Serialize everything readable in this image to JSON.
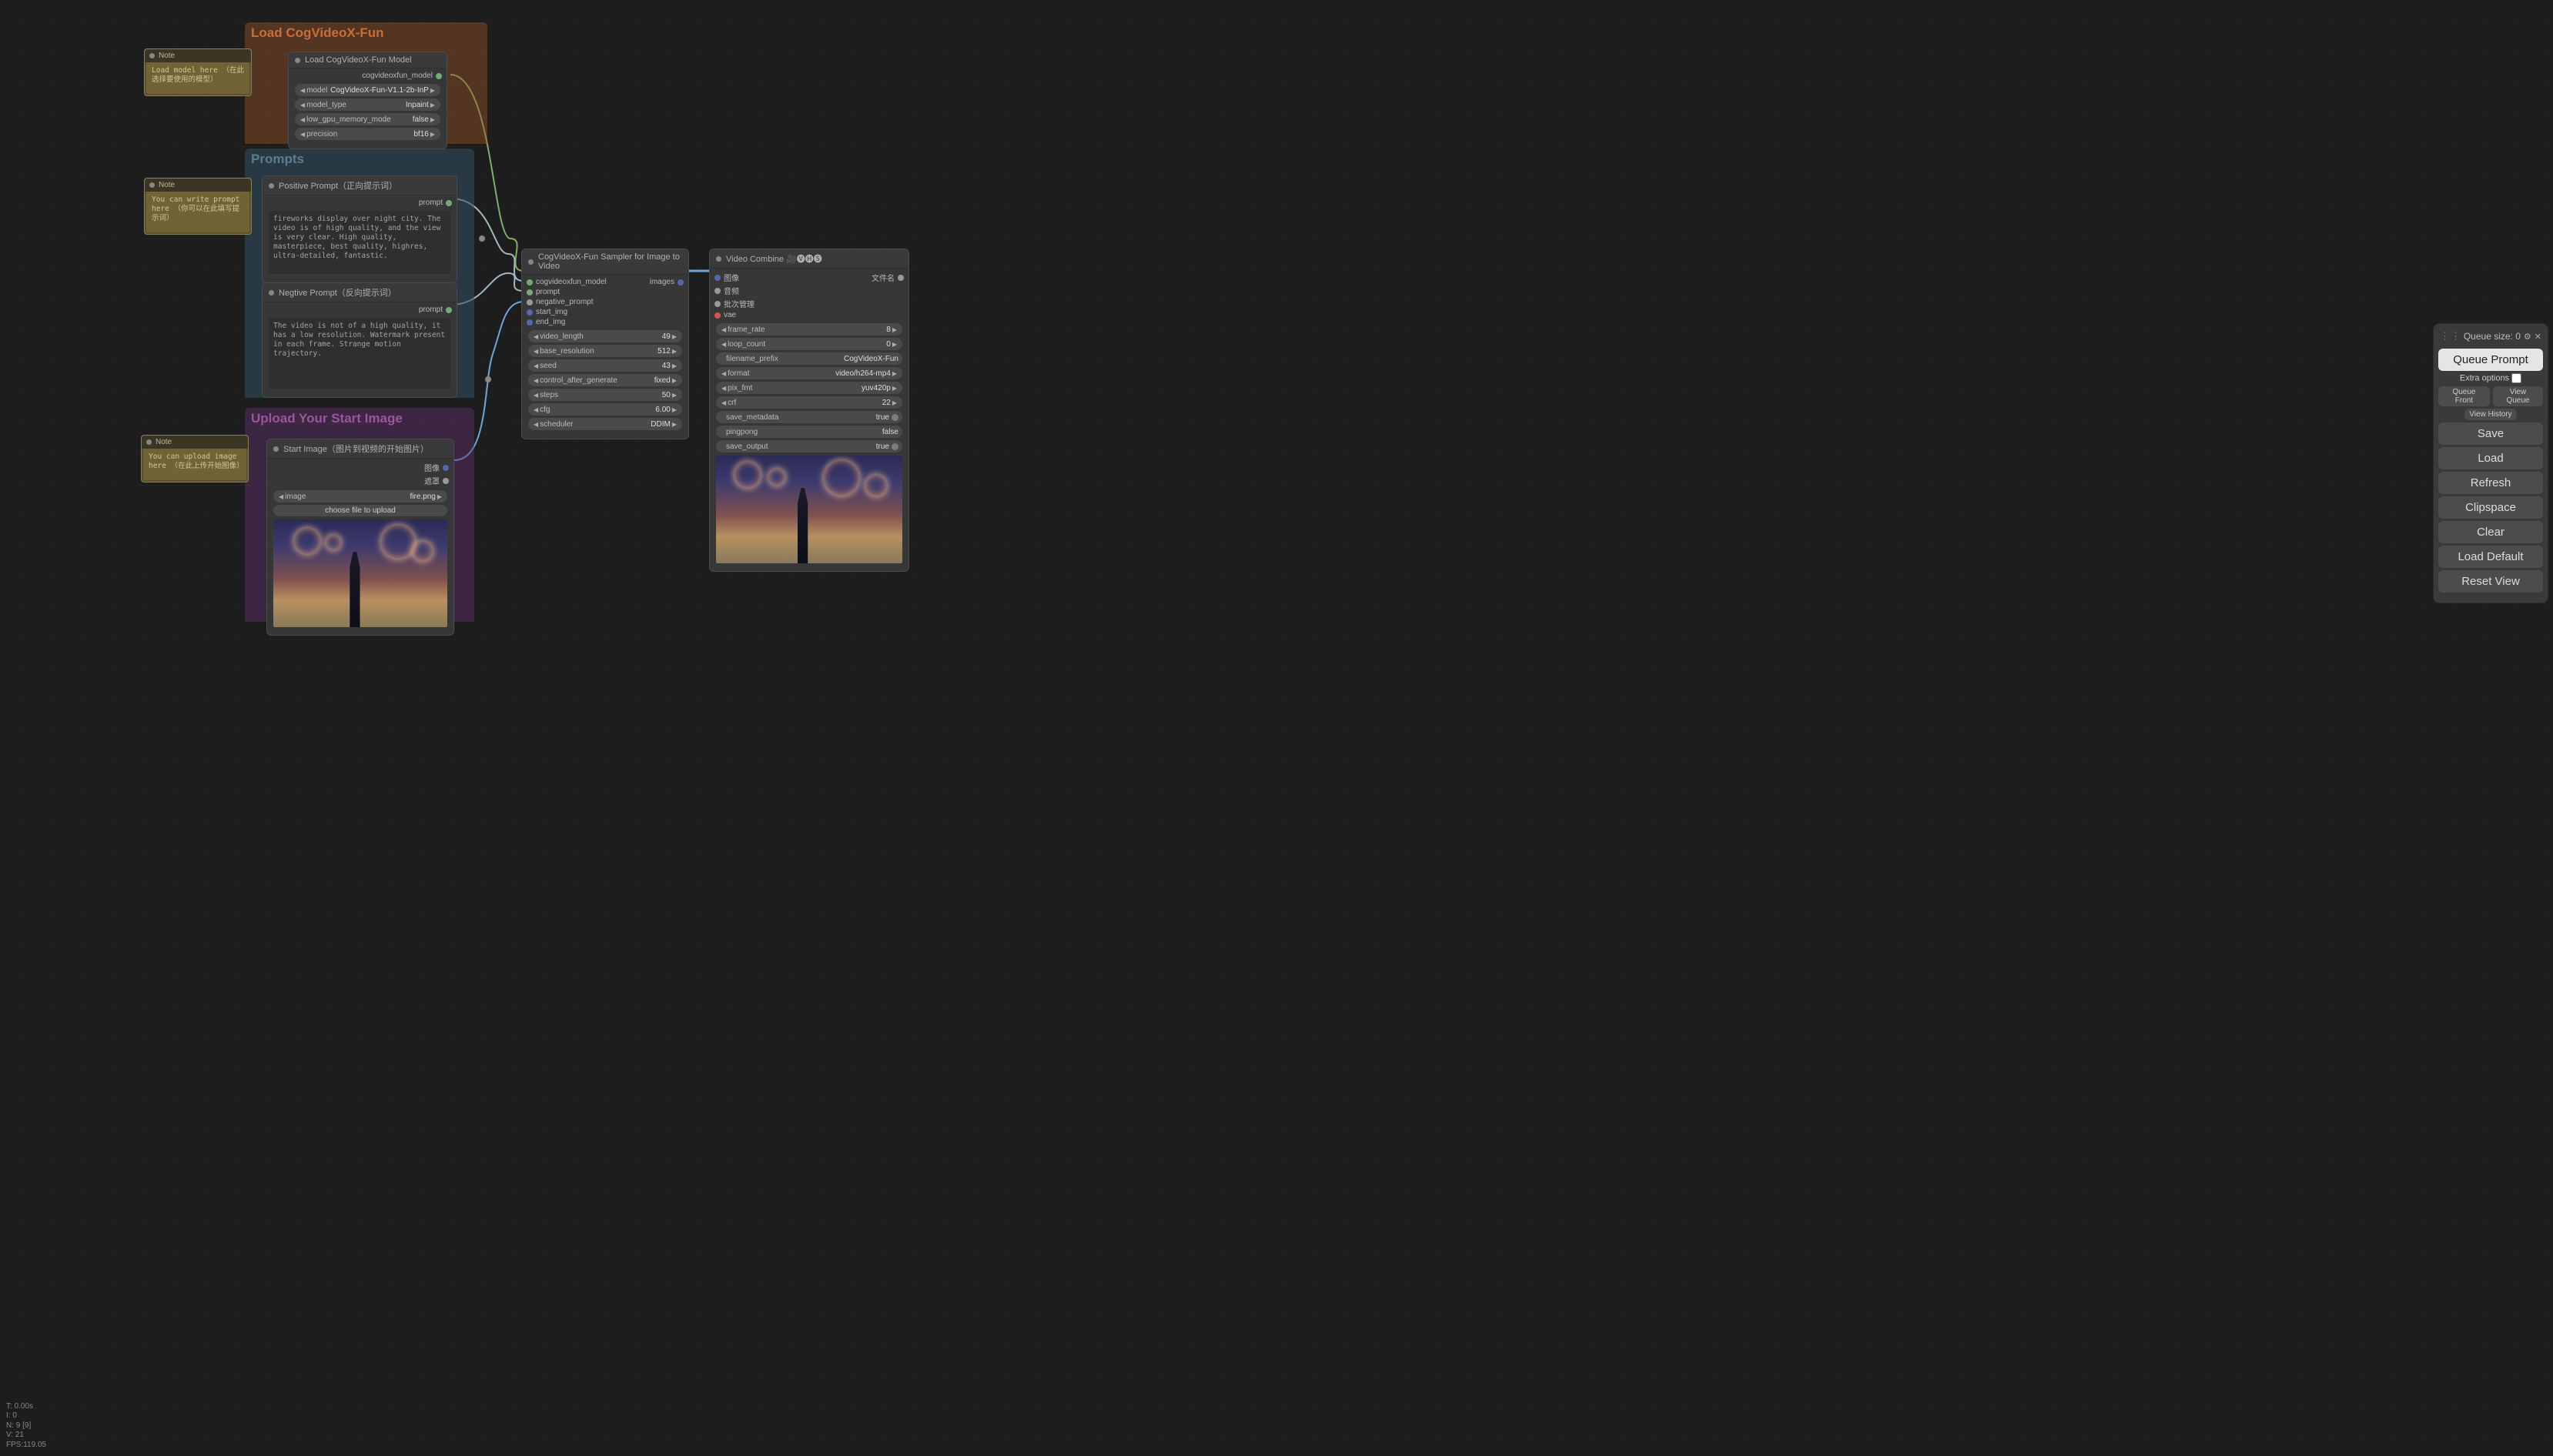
{
  "groups": {
    "load": {
      "title": "Load CogVideoX-Fun"
    },
    "prompts": {
      "title": "Prompts"
    },
    "upload": {
      "title": "Upload Your Start Image"
    }
  },
  "notes": {
    "n1": {
      "head": "Note",
      "body": "Load model here\n（在此选择要使用的模型）"
    },
    "n2": {
      "head": "Note",
      "body": "You can write prompt here\n（你可以在此填写提示词）"
    },
    "n3": {
      "head": "Note",
      "body": "You can upload image here\n（在此上传开始图像）"
    }
  },
  "load_model": {
    "title": "Load CogVideoX-Fun Model",
    "out": "cogvideoxfun_model",
    "model": {
      "label": "model",
      "value": "CogVideoX-Fun-V1.1-2b-InP"
    },
    "model_type": {
      "label": "model_type",
      "value": "Inpaint"
    },
    "low_gpu": {
      "label": "low_gpu_memory_mode",
      "value": "false"
    },
    "precision": {
      "label": "precision",
      "value": "bf16"
    }
  },
  "pos_prompt": {
    "title": "Positive Prompt（正向提示词）",
    "out": "prompt",
    "text": "fireworks display over night city. The video is of high quality, and the view is very clear. High quality, masterpiece, best quality, highres, ultra-detailed, fantastic."
  },
  "neg_prompt": {
    "title": "Negtive Prompt（反向提示词）",
    "out": "prompt",
    "text": "The video is not of a high quality, it has a low resolution. Watermark present in each frame. Strange motion trajectory."
  },
  "start_image": {
    "title": "Start Image（图片到视频的开始图片）",
    "out1": "图像",
    "out2": "遮罩",
    "image": {
      "label": "image",
      "value": "fire.png"
    },
    "choose": "choose file to upload"
  },
  "sampler": {
    "title": "CogVideoX-Fun Sampler for Image to Video",
    "ins": [
      "cogvideoxfun_model",
      "prompt",
      "negative_prompt",
      "start_img",
      "end_img"
    ],
    "out": "images",
    "video_length": {
      "label": "video_length",
      "value": "49"
    },
    "base_resolution": {
      "label": "base_resolution",
      "value": "512"
    },
    "seed": {
      "label": "seed",
      "value": "43"
    },
    "control_after_generate": {
      "label": "control_after_generate",
      "value": "fixed"
    },
    "steps": {
      "label": "steps",
      "value": "50"
    },
    "cfg": {
      "label": "cfg",
      "value": "6.00"
    },
    "scheduler": {
      "label": "scheduler",
      "value": "DDIM"
    }
  },
  "video_combine": {
    "title": "Video Combine 🎥🅥🅗🅢",
    "ins": [
      "图像",
      "音频",
      "批次管理",
      "vae"
    ],
    "out": "文件名",
    "frame_rate": {
      "label": "frame_rate",
      "value": "8"
    },
    "loop_count": {
      "label": "loop_count",
      "value": "0"
    },
    "filename_prefix": {
      "label": "filename_prefix",
      "value": "CogVideoX-Fun"
    },
    "format": {
      "label": "format",
      "value": "video/h264-mp4"
    },
    "pix_fmt": {
      "label": "pix_fmt",
      "value": "yuv420p"
    },
    "crf": {
      "label": "crf",
      "value": "22"
    },
    "save_metadata": {
      "label": "save_metadata",
      "value": "true"
    },
    "pingpong": {
      "label": "pingpong",
      "value": "false"
    },
    "save_output": {
      "label": "save_output",
      "value": "true"
    }
  },
  "sidepanel": {
    "queue_label": "Queue size: ",
    "queue_value": "0",
    "queue_prompt": "Queue Prompt",
    "extra": "Extra options",
    "queue_front": "Queue Front",
    "view_queue": "View Queue",
    "view_history": "View History",
    "save": "Save",
    "load": "Load",
    "refresh": "Refresh",
    "clipspace": "Clipspace",
    "clear": "Clear",
    "load_default": "Load Default",
    "reset_view": "Reset View"
  },
  "stats": {
    "t": "T: 0.00s",
    "i": "I: 0",
    "n": "N: 9 [9]",
    "v": "V: 21",
    "fps": "FPS:119.05"
  }
}
